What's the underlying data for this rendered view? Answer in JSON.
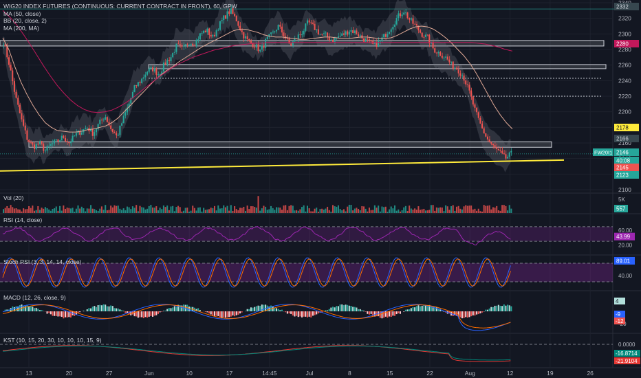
{
  "chart": {
    "title": "WIG20 INDEX FUTURES (CONTINUOUS: CURRENT CONTRACT IN FRONT), 60, GPW",
    "indicators_main": [
      "MA (50, close)",
      "BB (20, close, 2)",
      "MA (200, MA)"
    ],
    "ticker_tag": "FW20I1",
    "countdown": "40:08"
  },
  "colors": {
    "background": "#131722",
    "up": "#26a69a",
    "down": "#ef5350",
    "ma50": "#e0a996",
    "ma200": "#c2185b",
    "trendline": "#ffeb3b",
    "rsi": "#9c27b0",
    "stoch_k": "#2962ff",
    "stoch_d": "#ff6d00",
    "kst": "#e53935",
    "kst_signal": "#00897b"
  },
  "price_axis": {
    "ticks": [
      "2340",
      "2320",
      "2300",
      "2280",
      "2260",
      "2240",
      "2220",
      "2200",
      "2180",
      "2160",
      "2140",
      "2120",
      "2100"
    ],
    "tags": [
      {
        "text": "2332",
        "bg": "#37474f",
        "fg": "#d1d4dc",
        "value": 2332
      },
      {
        "text": "2280",
        "bg": "#c2185b",
        "fg": "#ffffff",
        "value": 2280
      },
      {
        "text": "2178",
        "bg": "#ffeb3b",
        "fg": "#131722",
        "value": 2178
      },
      {
        "text": "2166",
        "bg": "#37474f",
        "fg": "#d1d4dc",
        "value": 2166
      },
      {
        "text": "2146",
        "bg": "#26a69a",
        "fg": "#ffffff",
        "value": 2146
      },
      {
        "text": "40:08",
        "bg": "#26a69a",
        "fg": "#ffffff",
        "value": 2141
      },
      {
        "text": "2145",
        "bg": "#ef5350",
        "fg": "#ffffff",
        "value": 2136
      },
      {
        "text": "2123",
        "bg": "#26a69a",
        "fg": "#ffffff",
        "value": 2123
      }
    ]
  },
  "x_axis": {
    "labels": [
      "13",
      "20",
      "27",
      "Jun",
      "10",
      "17",
      "14:45",
      "Jul",
      "8",
      "15",
      "22",
      "Aug",
      "12",
      "19",
      "26"
    ]
  },
  "chart_data": {
    "type": "line",
    "main": {
      "ylim": [
        2100,
        2340
      ],
      "horizontal_zones": [
        {
          "value": 2288
        },
        {
          "value": 2258
        },
        {
          "value": 2158
        }
      ],
      "dotted_levels": [
        2243,
        2220
      ],
      "close_series": [
        2290,
        2260,
        2220,
        2190,
        2165,
        2155,
        2160,
        2150,
        2158,
        2162,
        2168,
        2160,
        2170,
        2175,
        2180,
        2172,
        2185,
        2195,
        2178,
        2168,
        2190,
        2210,
        2232,
        2240,
        2252,
        2255,
        2248,
        2262,
        2270,
        2285,
        2280,
        2290,
        2288,
        2300,
        2305,
        2295,
        2310,
        2322,
        2330,
        2318,
        2300,
        2290,
        2286,
        2278,
        2292,
        2300,
        2310,
        2298,
        2285,
        2295,
        2302,
        2315,
        2308,
        2300,
        2298,
        2292,
        2296,
        2300,
        2305,
        2302,
        2295,
        2290,
        2285,
        2290,
        2300,
        2310,
        2322,
        2330,
        2318,
        2310,
        2300,
        2295,
        2280,
        2275,
        2270,
        2260,
        2255,
        2245,
        2225,
        2200,
        2180,
        2165,
        2155,
        2148,
        2140,
        2146
      ],
      "ma50_series": [
        2295,
        2280,
        2258,
        2238,
        2222,
        2208,
        2196,
        2186,
        2180,
        2176,
        2175,
        2174,
        2174,
        2175,
        2177,
        2178,
        2180,
        2182,
        2186,
        2192,
        2200,
        2208,
        2216,
        2224,
        2232,
        2240,
        2247,
        2253,
        2258,
        2264,
        2269,
        2274,
        2279,
        2284,
        2288,
        2292,
        2296,
        2300,
        2304,
        2306,
        2306,
        2304,
        2302,
        2299,
        2297,
        2296,
        2296,
        2295,
        2294,
        2293,
        2293,
        2294,
        2295,
        2296,
        2296,
        2295,
        2294,
        2294,
        2295,
        2296,
        2296,
        2295,
        2294,
        2294,
        2295,
        2298,
        2302,
        2306,
        2309,
        2310,
        2309,
        2306,
        2301,
        2295,
        2288,
        2280,
        2272,
        2262,
        2250,
        2236,
        2222,
        2208,
        2196,
        2186,
        2178
      ],
      "ma200_series": [
        2330,
        2322,
        2312,
        2300,
        2287,
        2273,
        2259,
        2246,
        2234,
        2224,
        2215,
        2208,
        2203,
        2200,
        2199,
        2200,
        2202,
        2206,
        2211,
        2217,
        2224,
        2231,
        2238,
        2245,
        2251,
        2257,
        2262,
        2266,
        2270,
        2273,
        2276,
        2279,
        2281,
        2283,
        2285,
        2286,
        2287,
        2288,
        2288,
        2289,
        2289,
        2289,
        2289,
        2289,
        2289,
        2289,
        2289,
        2289,
        2289,
        2289,
        2289,
        2289,
        2289,
        2289,
        2289,
        2289,
        2289,
        2289,
        2289,
        2289,
        2289,
        2289,
        2289,
        2289,
        2289,
        2289,
        2289,
        2289,
        2289,
        2289,
        2288,
        2287,
        2285,
        2283,
        2280,
        2278
      ],
      "trendline": {
        "from": 2124,
        "to": 2138
      }
    },
    "volume": {
      "label": "Vol (20)",
      "axis_tag": "557",
      "axis_tick": "5K"
    },
    "rsi": {
      "label": "RSI (14, close)",
      "ticks": [
        "60.00",
        "20.00"
      ],
      "current": "43.99",
      "bands": [
        70,
        30
      ]
    },
    "stoch_rsi": {
      "label": "Stoch RSI (3, 3, 14, 14, close)",
      "ticks": [
        "40.00"
      ],
      "current": "89.01",
      "bands": [
        80,
        20
      ]
    },
    "macd": {
      "label": "MACD (12, 26, close, 9)",
      "ticks": [
        "-20"
      ],
      "tags": [
        "4",
        "-9",
        "-12"
      ]
    },
    "kst": {
      "label": "KST (10, 15, 20, 30, 10, 10, 10, 15, 9)",
      "ticks": [
        "0.0000"
      ],
      "tags": [
        "-16.8714",
        "-21.9104"
      ]
    }
  }
}
